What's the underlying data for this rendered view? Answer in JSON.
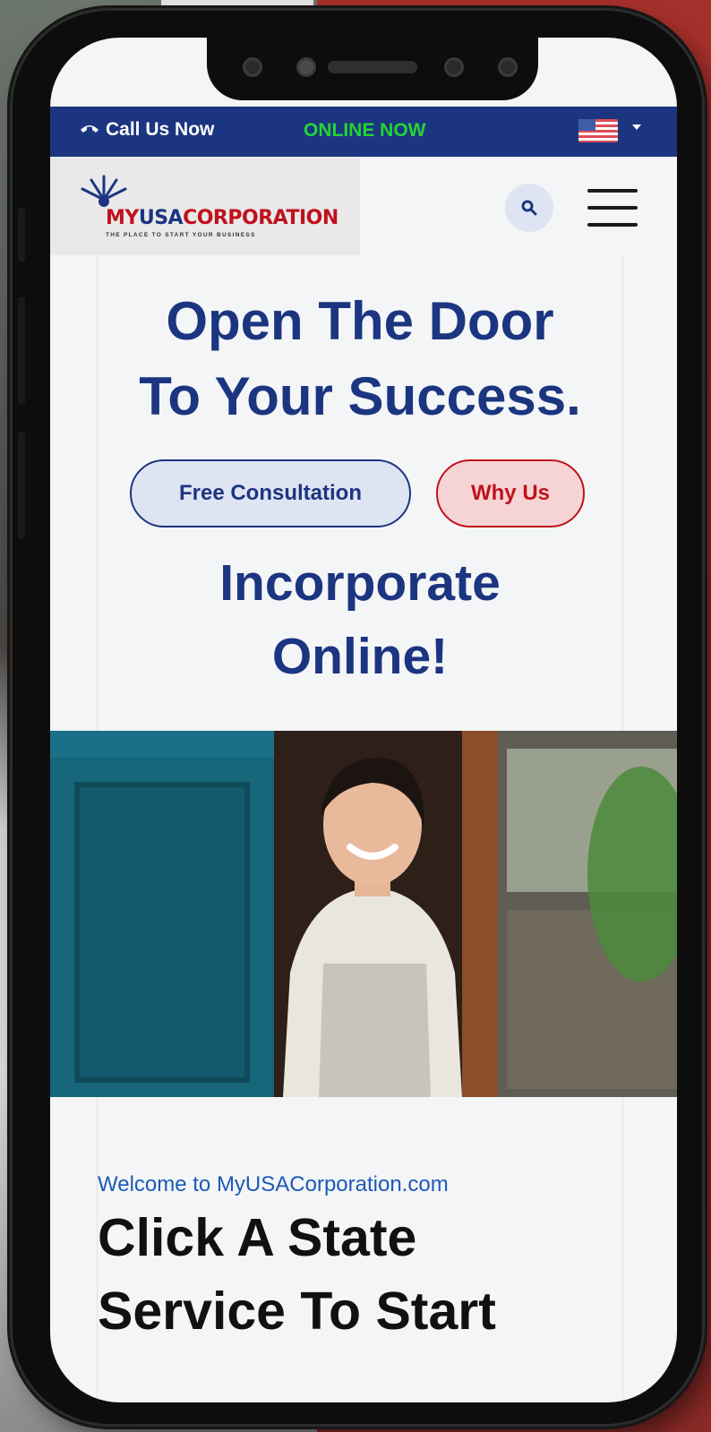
{
  "topbar": {
    "call_label": "Call Us Now",
    "status": "ONLINE NOW",
    "status_color": "#22d633",
    "background": "#1c3580"
  },
  "logo": {
    "my": "MY",
    "usa": "USA",
    "corp": "CORPORATION",
    "tagline": "THE PLACE TO START YOUR BUSINESS"
  },
  "hero": {
    "headline_line1": "Open The Door",
    "headline_line2": "To Your Success.",
    "buttons": {
      "consultation": "Free Consultation",
      "why_us": "Why Us"
    },
    "sub_line1": "Incorporate",
    "sub_line2": "Online!"
  },
  "welcome": {
    "text": "Welcome to MyUSACorporation.com",
    "cta_line1": "Click A State",
    "cta_line2": "Service To Start"
  },
  "colors": {
    "brand_blue": "#1c3580",
    "brand_red": "#c0121c",
    "link_blue": "#1c5ab8"
  }
}
